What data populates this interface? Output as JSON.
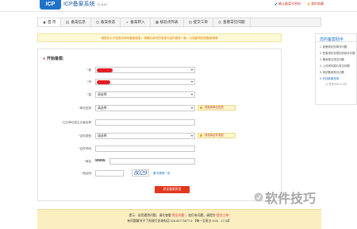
{
  "header": {
    "logo": "ICP",
    "title": "ICP备案系统",
    "version": "（V 5.0）",
    "links": [
      "确认备案号密码",
      "我的收藏"
    ]
  },
  "nav": {
    "items": [
      "首 页",
      "备案信息",
      "备案状态",
      "备案转入",
      "核验点列表",
      "提交工单",
      "查看常见问题"
    ]
  },
  "notice": "请您在以下信息中填写备案信息，请确认填写的信息与证件原件一致，以免影响您的备案审核",
  "form": {
    "title": "开始备案:",
    "labels": {
      "province": "省:",
      "city": "市:",
      "county": "县:",
      "unit_type": "单位性质:",
      "unit_name": "主办单位或主办者名称:",
      "cert_type": "证件类型:",
      "cert_no": "证件号码:",
      "domain": "域名:",
      "captcha": "验证码:"
    },
    "select_placeholder": "请选择",
    "unit_type_hint": "请选择单位性质",
    "cert_type_hint": "请选择证件类型",
    "www_prefix": "WWW.",
    "captcha_text": "8029",
    "refresh_text": "看不清换一张",
    "submit_label": "验证备案类型"
  },
  "sidebar": {
    "title": "您的备案助手",
    "items": [
      "1.  新备案如何填写问题",
      "2.  完善资料变更如何填写问题",
      "3.  备案单位常见问题",
      "4.  上传资料图片常见问题",
      "5.  网站备案常见问题",
      "6.  在线客服咨询"
    ],
    "time": "（工作日9:00-17:30）"
  },
  "footer": {
    "line1_a": "提示：若您遇到问题，请先查看",
    "line1_link1": "\"常见问题\"",
    "line1_b": "，若仍有问题，请提交",
    "line1_link2": "\"提交工单\"",
    "line2": "有问题解决不了再拨打咨询电话 028-62770877-6 【每一至周五 9:00 - 17:30】"
  },
  "watermark": "软件技巧",
  "colors": {
    "brand_blue": "#1e73c8",
    "submit_red": "#e2361d",
    "notice_bg": "#fef9d7",
    "footer_bg": "#fbeec1"
  }
}
